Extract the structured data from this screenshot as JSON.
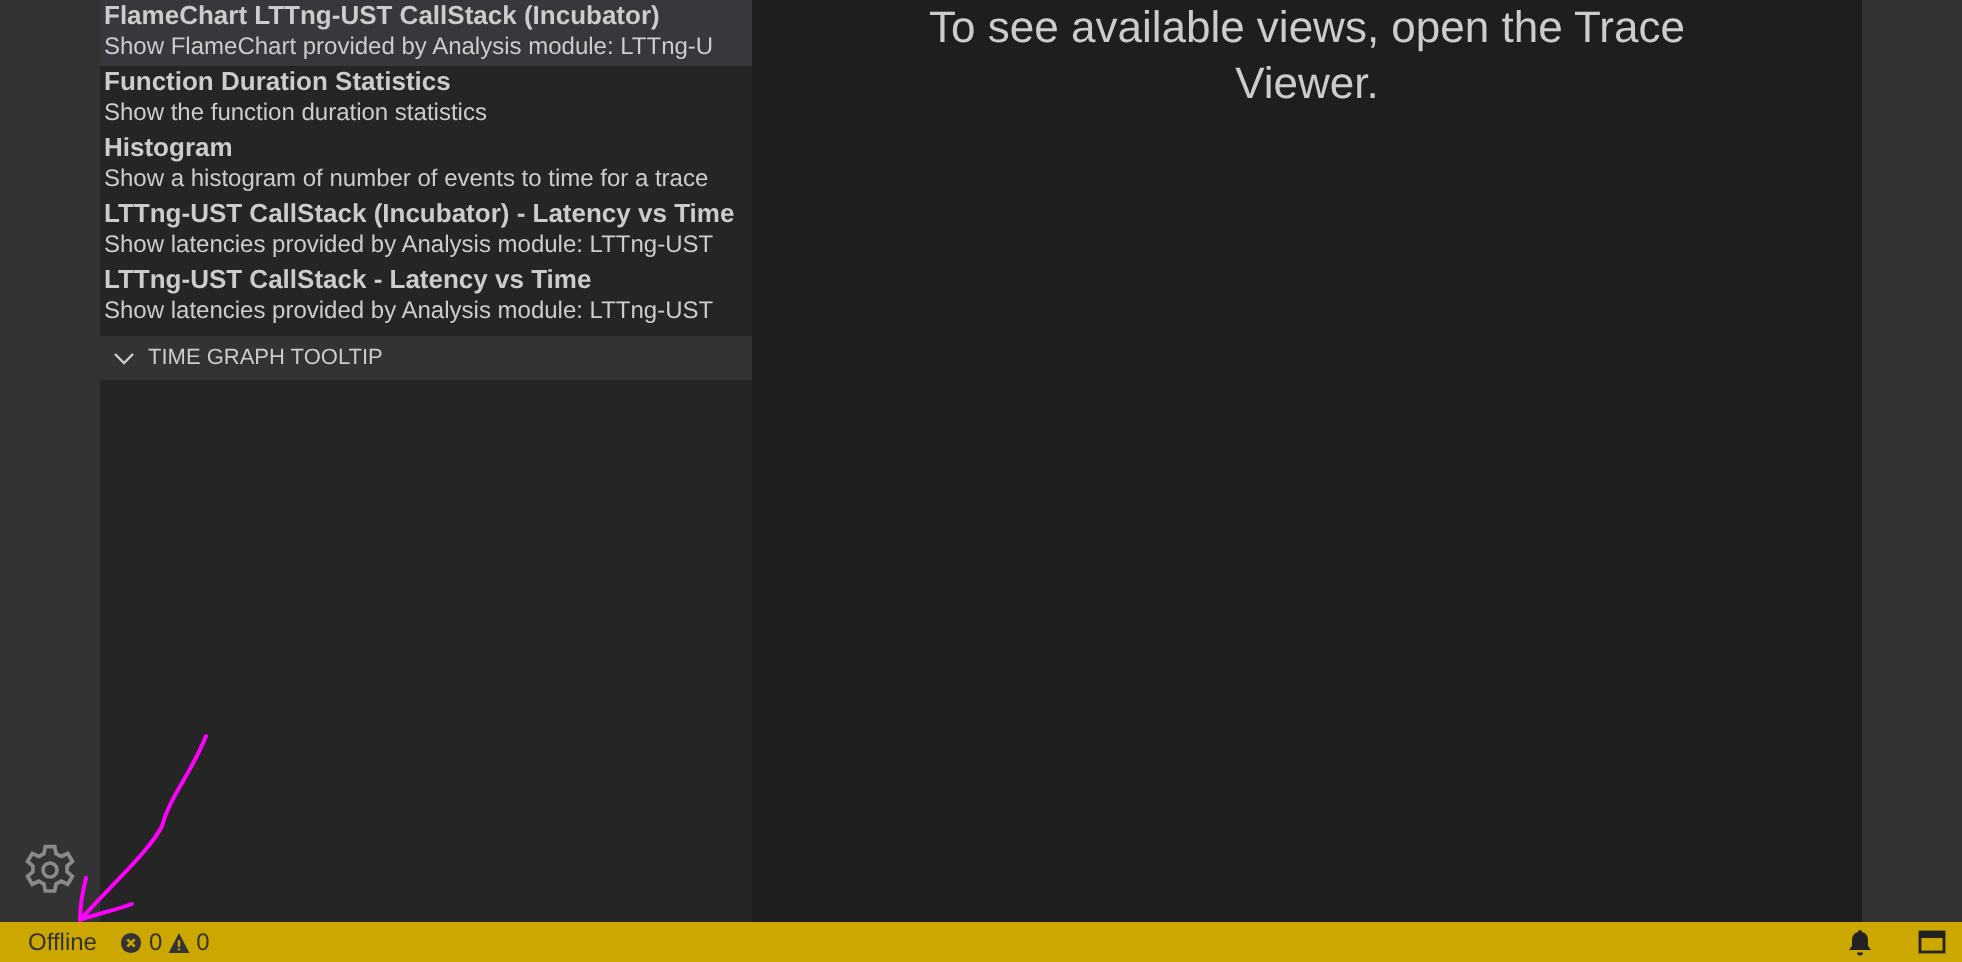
{
  "sidebar": {
    "views": [
      {
        "title": "FlameChart LTTng-UST CallStack (Incubator)",
        "description": "Show FlameChart provided by Analysis module: LTTng-U",
        "selected": true
      },
      {
        "title": "Function Duration Statistics",
        "description": "Show the function duration statistics",
        "selected": false
      },
      {
        "title": "Histogram",
        "description": "Show a histogram of number of events to time for a trace",
        "selected": false
      },
      {
        "title": "LTTng-UST CallStack (Incubator) - Latency vs Time",
        "description": "Show latencies provided by Analysis module: LTTng-UST",
        "selected": false
      },
      {
        "title": "LTTng-UST CallStack - Latency vs Time",
        "description": "Show latencies provided by Analysis module: LTTng-UST",
        "selected": false
      }
    ],
    "sections": [
      {
        "label": "TIME GRAPH TOOLTIP",
        "expanded": true
      }
    ]
  },
  "editor": {
    "message": "To see available views, open the Trace Viewer."
  },
  "status_bar": {
    "connection": "Offline",
    "errors": "0",
    "warnings": "0"
  }
}
